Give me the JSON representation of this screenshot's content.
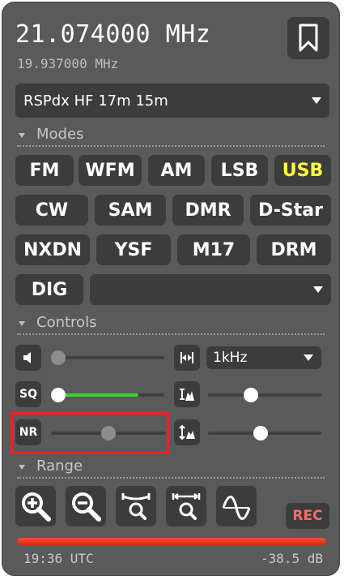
{
  "frequency": {
    "main": "21.074000 MHz",
    "secondary": "19.937000 MHz"
  },
  "profile": {
    "selected": "RSPdx HF 17m 15m"
  },
  "sections": {
    "modes": "Modes",
    "controls": "Controls",
    "range": "Range"
  },
  "modes": {
    "row1": [
      "FM",
      "WFM",
      "AM",
      "LSB",
      "USB"
    ],
    "row2": [
      "CW",
      "SAM",
      "DMR",
      "D-Star"
    ],
    "row3": [
      "NXDN",
      "YSF",
      "M17",
      "DRM"
    ],
    "row4": [
      "DIG"
    ],
    "active": "USB",
    "active_color": "#ffff3c",
    "dig_submode": ""
  },
  "controls": {
    "volume_level": 0.0,
    "squelch_label": "SQ",
    "squelch_level": 0.0,
    "squelch_meter_fill": 0.8,
    "squelch_meter_color": "#34d634",
    "nr_label": "NR",
    "nr_level": 0.5,
    "bandwidth_selected": "1kHz",
    "waterfall_min_level": 0.5,
    "waterfall_max_level": 0.4
  },
  "range": {
    "rec_label": "REC",
    "rec_color": "#ff6a6a"
  },
  "status": {
    "time": "19:36 UTC",
    "level": "-38.5 dB"
  },
  "icons": {
    "bookmark": "bookmark-icon",
    "zoom_in": "zoom-in-icon",
    "zoom_out": "zoom-out-icon",
    "zoom_to_band": "zoom-band-icon",
    "zoom_fit": "zoom-fit-icon",
    "spectrum": "waveform-icon"
  }
}
